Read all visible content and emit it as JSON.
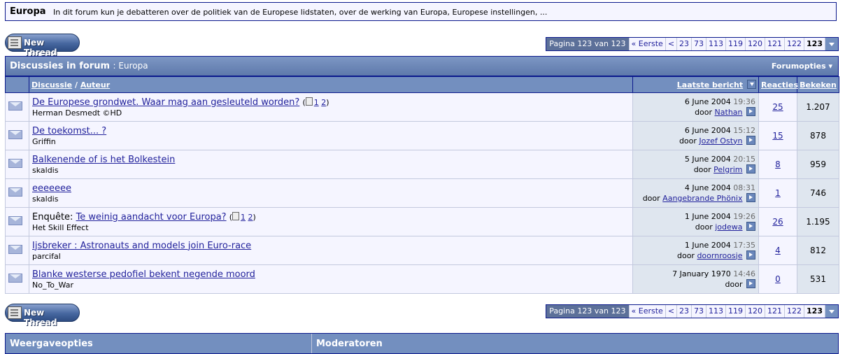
{
  "forum": {
    "name": "Europa",
    "description": "In dit forum kun je debatteren over de politiek van de Europese lidstaten, over de werking van Europa, Europese instellingen, ..."
  },
  "new_thread_label": "New Thread",
  "pagenav": {
    "label": "Pagina 123 van 123",
    "first": "« Eerste",
    "prev": "<",
    "pages": [
      "23",
      "73",
      "113",
      "119",
      "120",
      "121",
      "122"
    ],
    "current": "123"
  },
  "category": {
    "title": "Discussies in forum",
    "subtitle": ": Europa",
    "options": "Forumopties"
  },
  "columns": {
    "thread": "Discussie",
    "author": "Auteur",
    "last_post": "Laatste bericht",
    "replies": "Reacties",
    "views": "Bekeken"
  },
  "threads": [
    {
      "prefix": "",
      "title": "De Europese grondwet. Waar mag aan gesleuteld worden?",
      "pages": [
        "1",
        "2"
      ],
      "author": "Herman Desmedt ©HD",
      "date": "6 June 2004",
      "time": "19:36",
      "by": "door",
      "last_poster": "Nathan",
      "replies": "25",
      "views": "1.207"
    },
    {
      "prefix": "",
      "title": "De toekomst... ?",
      "pages": [],
      "author": "Griffin",
      "date": "6 June 2004",
      "time": "15:12",
      "by": "door",
      "last_poster": "Jozef Ostyn",
      "replies": "15",
      "views": "878"
    },
    {
      "prefix": "",
      "title": "Balkenende of is het Bolkestein",
      "pages": [],
      "author": "skaldis",
      "date": "5 June 2004",
      "time": "20:15",
      "by": "door",
      "last_poster": "Pelgrim",
      "replies": "8",
      "views": "959"
    },
    {
      "prefix": "",
      "title": "eeeeeee",
      "pages": [],
      "author": "skaldis",
      "date": "4 June 2004",
      "time": "08:31",
      "by": "door",
      "last_poster": "Aangebrande Phönix",
      "replies": "1",
      "views": "746"
    },
    {
      "prefix": "Enquête:",
      "title": "Te weinig aandacht voor Europa?",
      "pages": [
        "1",
        "2"
      ],
      "author": "Het Skill Effect",
      "date": "1 June 2004",
      "time": "19:26",
      "by": "door",
      "last_poster": "jodewa",
      "replies": "26",
      "views": "1.195"
    },
    {
      "prefix": "",
      "title": "Ijsbreker : Astronauts and models join Euro-race",
      "pages": [],
      "author": "parcifal",
      "date": "1 June 2004",
      "time": "17:35",
      "by": "door",
      "last_poster": "doornroosje",
      "replies": "4",
      "views": "812"
    },
    {
      "prefix": "",
      "title": "Blanke westerse pedofiel bekent negende moord",
      "pages": [],
      "author": "No_To_War",
      "date": "7 January 1970",
      "time": "14:46",
      "by": "door",
      "last_poster": "",
      "replies": "0",
      "views": "531"
    }
  ],
  "bottom": {
    "display_options": "Weergaveopties",
    "moderators": "Moderatoren"
  },
  "colors": {
    "border": "#0b198c",
    "header_bg": "#738fbf",
    "alt_row": "#dfe6ef",
    "link": "#22229c"
  }
}
